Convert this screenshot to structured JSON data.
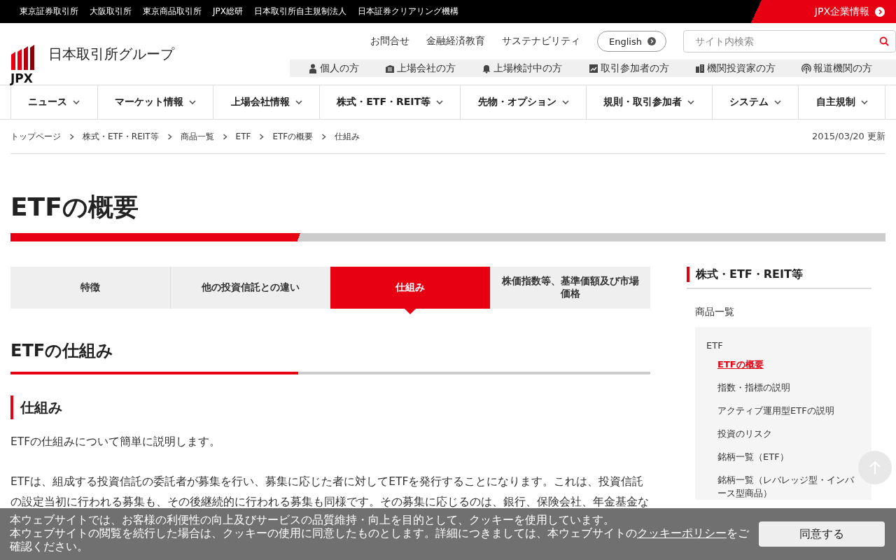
{
  "top_bar": {
    "links": [
      "東京証券取引所",
      "大阪取引所",
      "東京商品取引所",
      "JPX総研",
      "日本取引所自主規制法人",
      "日本証券クリアリング機構"
    ],
    "corporate_link": "JPX企業情報"
  },
  "header": {
    "logo_mark": "JPX",
    "logo_text": "日本取引所グループ",
    "utility_links": [
      "お問合せ",
      "金融経済教育",
      "サステナビリティ"
    ],
    "language_button": "English",
    "search": {
      "placeholder": "サイト内検索"
    },
    "audience_links": [
      {
        "kind": "person",
        "label": "個人の方"
      },
      {
        "kind": "building",
        "label": "上場会社の方"
      },
      {
        "kind": "bell",
        "label": "上場検討中の方"
      },
      {
        "kind": "chart",
        "label": "取引参加者の方"
      },
      {
        "kind": "office",
        "label": "機関投資家の方"
      },
      {
        "kind": "broadcast",
        "label": "報道機関の方"
      }
    ]
  },
  "nav": [
    "ニュース",
    "マーケット情報",
    "上場会社情報",
    "株式・ETF・REIT等",
    "先物・オプション",
    "規則・取引参加者",
    "システム",
    "自主規制"
  ],
  "breadcrumb": [
    "トップページ",
    "株式・ETF・REIT等",
    "商品一覧",
    "ETF",
    "ETFの概要",
    "仕組み"
  ],
  "updated": "2015/03/20 更新",
  "page_title": "ETFの概要",
  "tabs": [
    {
      "label": "特徴",
      "selected": false
    },
    {
      "label": "他の投資信託との違い",
      "selected": false
    },
    {
      "label": "仕組み",
      "selected": true
    },
    {
      "label": "株価指数等、基準価額及び市場価格",
      "selected": false
    }
  ],
  "section_title": "ETFの仕組み",
  "subsection_title": "仕組み",
  "paragraphs": [
    "ETFの仕組みについて簡単に説明します。",
    "ETFは、組成する投資信託の委託者が募集を行い、募集に応じた者に対してETFを発行することになります。これは、投資信託の設定当初に行われる募集も、その後継続的に行われる募集も同様です。その募集に応じるのは、銀行、保険会社、年金基金な"
  ],
  "sidebar": {
    "title": "株式・ETF・REIT等",
    "items": [
      {
        "label": "商品一覧",
        "selected": false,
        "children": [
          {
            "label": "ETF",
            "selected": false,
            "children": [
              {
                "label": "ETFの概要",
                "selected": true
              },
              {
                "label": "指数・指標の説明",
                "selected": false
              },
              {
                "label": "アクティブ運用型ETFの説明",
                "selected": false
              },
              {
                "label": "投資のリスク",
                "selected": false
              },
              {
                "label": "銘柄一覧（ETF）",
                "selected": false
              },
              {
                "label": "銘柄一覧（レバレッジ型・インバース型商品）",
                "selected": false
              }
            ]
          }
        ]
      }
    ]
  },
  "cookie_banner": {
    "line_1": "本ウェブサイトでは、お客様の利便性の向上及びサービスの品質維持・向上を目的として、クッキーを使用しています。",
    "line_2_before": "本ウェブサイトの閲覧を続行した場合は、クッキーの使用に同意したものとします。詳細につきましては、本ウェブサイトの",
    "policy_link": "クッキーポリシー",
    "line_2_after": "をご確認ください。",
    "accept_button": "同意する"
  }
}
